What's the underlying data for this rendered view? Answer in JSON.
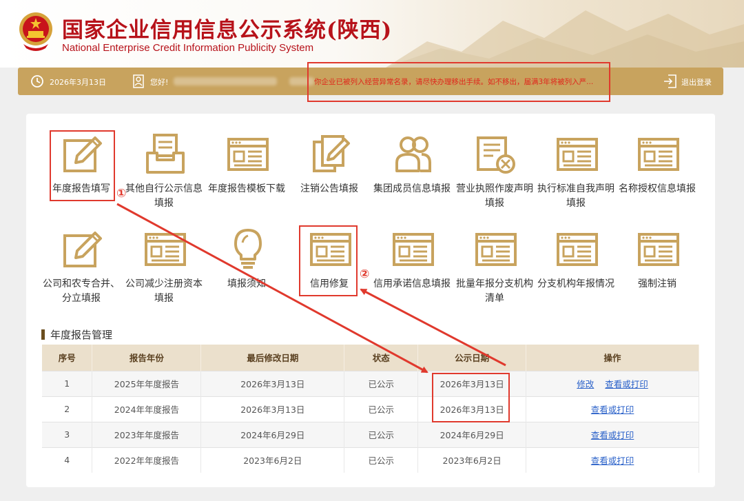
{
  "header": {
    "title": "国家企业信用信息公示系统(陕西)",
    "subtitle": "National Enterprise Credit Information Publicity System"
  },
  "topbar": {
    "date": "2026年3月13日",
    "greeting": "您好!",
    "notice": "你企业已被列入经营异常名录，请尽快办理移出手续。如不移出，届满3年将被列入严...",
    "logout": "退出登录"
  },
  "tiles": [
    {
      "label": "年度报告填写",
      "icon": "edit-icon"
    },
    {
      "label": "其他自行公示信息填报",
      "icon": "inbox-icon"
    },
    {
      "label": "年度报告模板下载",
      "icon": "form-window-icon"
    },
    {
      "label": "注销公告填报",
      "icon": "copy-pen-icon"
    },
    {
      "label": "集团成员信息填报",
      "icon": "users-icon"
    },
    {
      "label": "营业执照作废声明填报",
      "icon": "document-cancel-icon"
    },
    {
      "label": "执行标准自我声明填报",
      "icon": "form-window-icon"
    },
    {
      "label": "名称授权信息填报",
      "icon": "form-window-icon"
    },
    {
      "label": "公司和农专合并、分立填报",
      "icon": "edit-icon"
    },
    {
      "label": "公司减少注册资本填报",
      "icon": "form-window-icon"
    },
    {
      "label": "填报须知",
      "icon": "lightbulb-icon"
    },
    {
      "label": "信用修复",
      "icon": "form-window-icon"
    },
    {
      "label": "信用承诺信息填报",
      "icon": "form-window-icon"
    },
    {
      "label": "批量年报分支机构清单",
      "icon": "form-window-icon"
    },
    {
      "label": "分支机构年报情况",
      "icon": "form-window-icon"
    },
    {
      "label": "强制注销",
      "icon": "form-window-icon"
    }
  ],
  "annotations": {
    "one": "①",
    "two": "②"
  },
  "section": {
    "title": "年度报告管理"
  },
  "table": {
    "headers": [
      "序号",
      "报告年份",
      "最后修改日期",
      "状态",
      "公示日期",
      "操作"
    ],
    "rows": [
      {
        "no": "1",
        "year": "2025年年度报告",
        "modified": "2026年3月13日",
        "status": "已公示",
        "published": "2026年3月13日",
        "actions": [
          "修改",
          "查看或打印"
        ]
      },
      {
        "no": "2",
        "year": "2024年年度报告",
        "modified": "2026年3月13日",
        "status": "已公示",
        "published": "2026年3月13日",
        "actions": [
          "查看或打印"
        ]
      },
      {
        "no": "3",
        "year": "2023年年度报告",
        "modified": "2024年6月29日",
        "status": "已公示",
        "published": "2024年6月29日",
        "actions": [
          "查看或打印"
        ]
      },
      {
        "no": "4",
        "year": "2022年年度报告",
        "modified": "2023年6月2日",
        "status": "已公示",
        "published": "2023年6月2日",
        "actions": [
          "查看或打印"
        ]
      }
    ]
  },
  "colors": {
    "accent": "#c8a35e",
    "brand_red": "#b7121a",
    "alert_red": "#e0392d",
    "link": "#2a61c9"
  }
}
